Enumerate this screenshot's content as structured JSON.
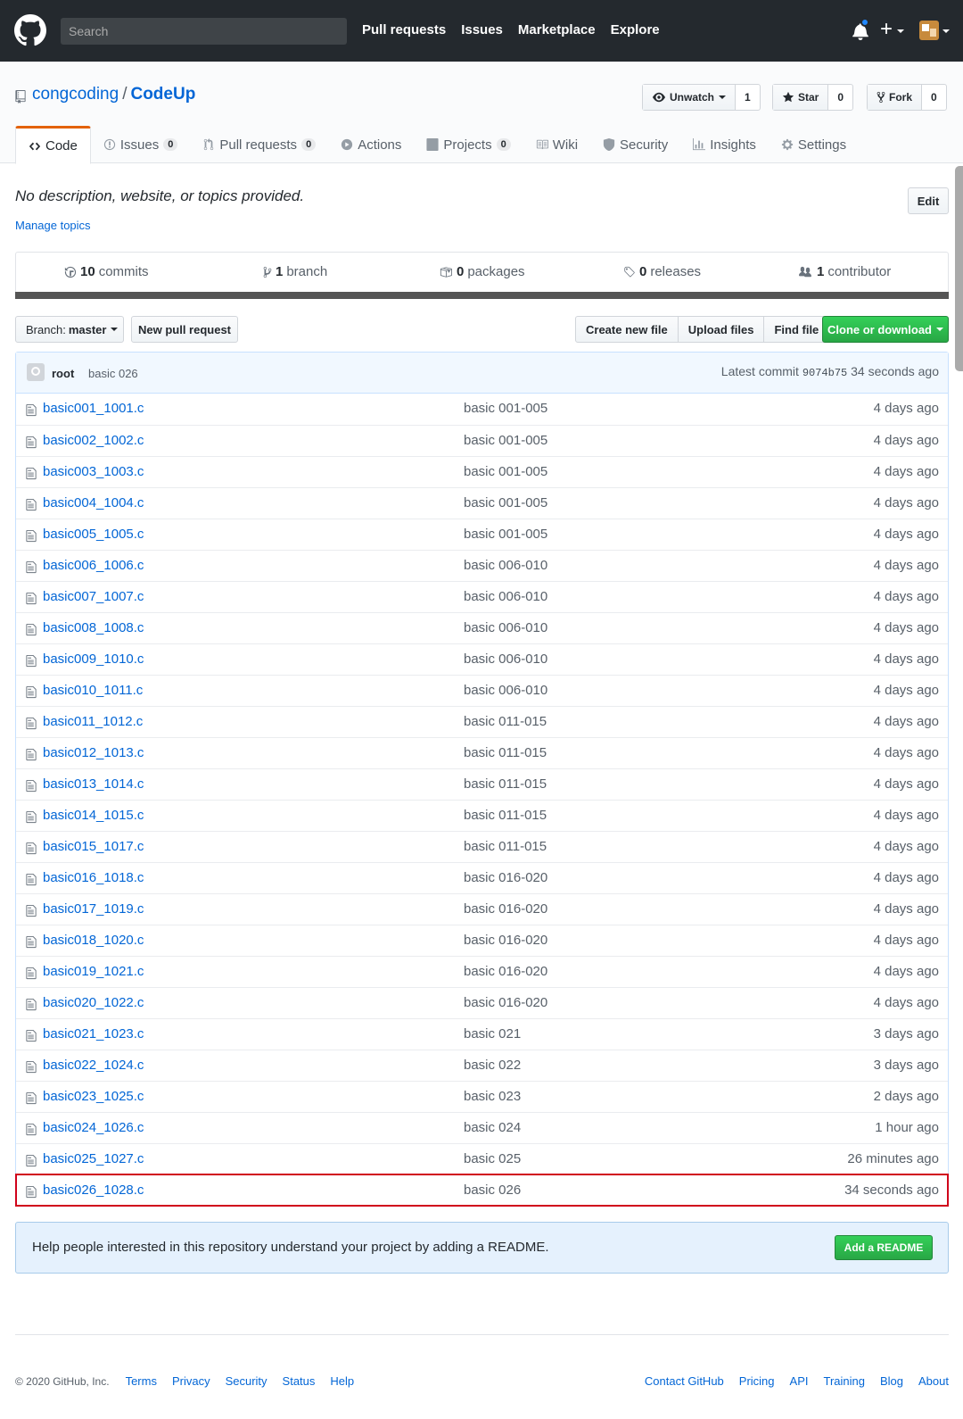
{
  "header": {
    "search_placeholder": "Search",
    "nav": [
      "Pull requests",
      "Issues",
      "Marketplace",
      "Explore"
    ],
    "plus": "+"
  },
  "repo": {
    "owner": "congcoding",
    "separator": "/",
    "name": "CodeUp",
    "unwatch_label": "Unwatch",
    "watch_count": "1",
    "star_label": "Star",
    "star_count": "0",
    "fork_label": "Fork",
    "fork_count": "0"
  },
  "tabs": [
    {
      "label": "Code",
      "icon": "code-icon",
      "counter": ""
    },
    {
      "label": "Issues",
      "icon": "issue-icon",
      "counter": "0"
    },
    {
      "label": "Pull requests",
      "icon": "pull-request-icon",
      "counter": "0"
    },
    {
      "label": "Actions",
      "icon": "play-icon",
      "counter": ""
    },
    {
      "label": "Projects",
      "icon": "project-icon",
      "counter": "0"
    },
    {
      "label": "Wiki",
      "icon": "book-icon",
      "counter": ""
    },
    {
      "label": "Security",
      "icon": "shield-icon",
      "counter": ""
    },
    {
      "label": "Insights",
      "icon": "graph-icon",
      "counter": ""
    },
    {
      "label": "Settings",
      "icon": "gear-icon",
      "counter": ""
    }
  ],
  "description": {
    "text": "No description, website, or topics provided.",
    "manage_topics": "Manage topics",
    "edit": "Edit"
  },
  "summary": {
    "commits_count": "10",
    "commits_label": "commits",
    "branch_count": "1",
    "branch_label": "branch",
    "packages_count": "0",
    "packages_label": "packages",
    "releases_count": "0",
    "releases_label": "releases",
    "contributor_count": "1",
    "contributor_label": "contributor"
  },
  "filenav": {
    "branch_prefix": "Branch:",
    "branch_name": "master",
    "new_pr": "New pull request",
    "create_file": "Create new file",
    "upload_files": "Upload files",
    "find_file": "Find file",
    "clone": "Clone or download"
  },
  "commit": {
    "user": "root",
    "message": "basic 026",
    "latest_label": "Latest commit",
    "sha": "9074b75",
    "age": "34 seconds ago"
  },
  "files": [
    {
      "name": "basic001_1001.c",
      "message": "basic 001-005",
      "age": "4 days ago"
    },
    {
      "name": "basic002_1002.c",
      "message": "basic 001-005",
      "age": "4 days ago"
    },
    {
      "name": "basic003_1003.c",
      "message": "basic 001-005",
      "age": "4 days ago"
    },
    {
      "name": "basic004_1004.c",
      "message": "basic 001-005",
      "age": "4 days ago"
    },
    {
      "name": "basic005_1005.c",
      "message": "basic 001-005",
      "age": "4 days ago"
    },
    {
      "name": "basic006_1006.c",
      "message": "basic 006-010",
      "age": "4 days ago"
    },
    {
      "name": "basic007_1007.c",
      "message": "basic 006-010",
      "age": "4 days ago"
    },
    {
      "name": "basic008_1008.c",
      "message": "basic 006-010",
      "age": "4 days ago"
    },
    {
      "name": "basic009_1010.c",
      "message": "basic 006-010",
      "age": "4 days ago"
    },
    {
      "name": "basic010_1011.c",
      "message": "basic 006-010",
      "age": "4 days ago"
    },
    {
      "name": "basic011_1012.c",
      "message": "basic 011-015",
      "age": "4 days ago"
    },
    {
      "name": "basic012_1013.c",
      "message": "basic 011-015",
      "age": "4 days ago"
    },
    {
      "name": "basic013_1014.c",
      "message": "basic 011-015",
      "age": "4 days ago"
    },
    {
      "name": "basic014_1015.c",
      "message": "basic 011-015",
      "age": "4 days ago"
    },
    {
      "name": "basic015_1017.c",
      "message": "basic 011-015",
      "age": "4 days ago"
    },
    {
      "name": "basic016_1018.c",
      "message": "basic 016-020",
      "age": "4 days ago"
    },
    {
      "name": "basic017_1019.c",
      "message": "basic 016-020",
      "age": "4 days ago"
    },
    {
      "name": "basic018_1020.c",
      "message": "basic 016-020",
      "age": "4 days ago"
    },
    {
      "name": "basic019_1021.c",
      "message": "basic 016-020",
      "age": "4 days ago"
    },
    {
      "name": "basic020_1022.c",
      "message": "basic 016-020",
      "age": "4 days ago"
    },
    {
      "name": "basic021_1023.c",
      "message": "basic 021",
      "age": "3 days ago"
    },
    {
      "name": "basic022_1024.c",
      "message": "basic 022",
      "age": "3 days ago"
    },
    {
      "name": "basic023_1025.c",
      "message": "basic 023",
      "age": "2 days ago"
    },
    {
      "name": "basic024_1026.c",
      "message": "basic 024",
      "age": "1 hour ago"
    },
    {
      "name": "basic025_1027.c",
      "message": "basic 025",
      "age": "26 minutes ago"
    },
    {
      "name": "basic026_1028.c",
      "message": "basic 026",
      "age": "34 seconds ago",
      "highlighted": true
    }
  ],
  "readme": {
    "text": "Help people interested in this repository understand your project by adding a README.",
    "button": "Add a README"
  },
  "footer": {
    "copyright": "© 2020 GitHub, Inc.",
    "left_links": [
      "Terms",
      "Privacy",
      "Security",
      "Status",
      "Help"
    ],
    "right_links": [
      "Contact GitHub",
      "Pricing",
      "API",
      "Training",
      "Blog",
      "About"
    ]
  },
  "colors": {
    "header_bg": "#24292e",
    "link": "#0366d6",
    "accent_tab": "#e36209",
    "green_button": "#28a745",
    "highlight_outline": "#d0021b",
    "language_bar": "#555555"
  }
}
